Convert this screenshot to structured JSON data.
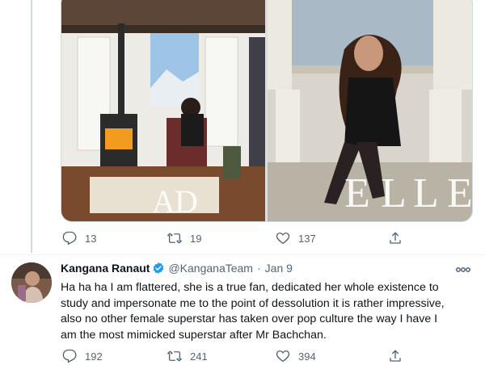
{
  "previous_tweet": {
    "images": [
      {
        "icon": "living-room-photo",
        "overlay_text": "AD"
      },
      {
        "icon": "magazine-cover-photo",
        "overlay_text": "ELLE"
      }
    ],
    "actions": {
      "replies": "13",
      "retweets": "19",
      "likes": "137"
    }
  },
  "tweet": {
    "author_name": "Kangana Ranaut",
    "handle": "@KanganaTeam",
    "separator": "·",
    "date": "Jan 9",
    "text_lines": [
      "Ha ha ha I am flattered, she is a true fan, dedicated her whole existence to",
      "study and impersonate me to the point of dessolution it is rather impressive,",
      "also no other female superstar has taken over pop culture the way I have I",
      "am the most mimicked superstar after Mr Bachchan."
    ],
    "actions": {
      "replies": "192",
      "retweets": "241",
      "likes": "394"
    }
  },
  "colors": {
    "accent_blue": "#1d9bf0",
    "secondary_text": "#536471",
    "thread_line": "#cfd9de"
  }
}
